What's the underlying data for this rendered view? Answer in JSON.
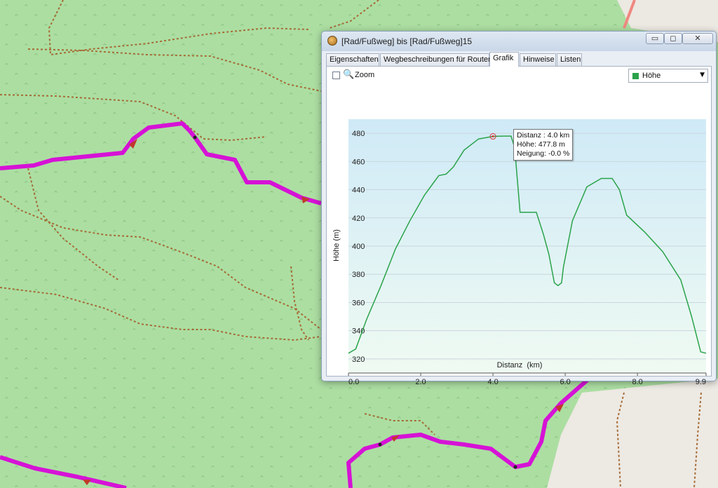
{
  "window": {
    "title": "[Rad/Fußweg] bis [Rad/Fußweg]15",
    "controls": {
      "minimize": "▭",
      "maximize": "◻",
      "close": "✕"
    }
  },
  "tabs": [
    {
      "label": "Eigenschaften",
      "active": false
    },
    {
      "label": "Wegbeschreibungen für Routen",
      "active": false
    },
    {
      "label": "Grafik",
      "active": true
    },
    {
      "label": "Hinweise",
      "active": false
    },
    {
      "label": "Listen",
      "active": false
    }
  ],
  "toolbar": {
    "zoom_label": "Zoom",
    "zoom_checked": false,
    "series_selected": "Höhe",
    "series_color": "#2aa34a"
  },
  "tooltip": {
    "distance": "Distanz : 4.0 km",
    "height": "Höhe: 477.8 m",
    "slope": "Neigung: -0.0 %"
  },
  "chart_data": {
    "type": "area",
    "xlabel": "Distanz  (km)",
    "ylabel": "Höhe (m)",
    "xlim": [
      0,
      9.9
    ],
    "ylim": [
      310,
      490
    ],
    "x_ticks": [
      0.0,
      2.0,
      4.0,
      6.0,
      8.0,
      9.9
    ],
    "x_tick_labels": [
      "0.0",
      "2.0",
      "4.0",
      "6.0",
      "8.0",
      "9.9"
    ],
    "y_ticks": [
      320,
      340,
      360,
      380,
      400,
      420,
      440,
      460,
      480
    ],
    "grid": true,
    "line_color": "#2aa34a",
    "highlight_point": {
      "x": 4.0,
      "y": 477.8
    },
    "series": [
      {
        "name": "Höhe",
        "x": [
          0.0,
          0.2,
          0.5,
          0.9,
          1.3,
          1.7,
          2.1,
          2.3,
          2.5,
          2.7,
          2.9,
          3.2,
          3.6,
          4.0,
          4.3,
          4.5,
          4.6,
          4.75,
          5.2,
          5.4,
          5.55,
          5.7,
          5.8,
          5.9,
          5.95,
          6.2,
          6.6,
          7.0,
          7.3,
          7.5,
          7.7,
          8.2,
          8.7,
          9.2,
          9.5,
          9.75,
          9.9
        ],
        "y": [
          324,
          327,
          348,
          372,
          398,
          418,
          436,
          443,
          450,
          451,
          456,
          468,
          476,
          477.8,
          478,
          478,
          470,
          424,
          424,
          408,
          394,
          374,
          372,
          374,
          385,
          418,
          442,
          448,
          448,
          440,
          422,
          410,
          396,
          376,
          350,
          325,
          324
        ]
      }
    ]
  }
}
